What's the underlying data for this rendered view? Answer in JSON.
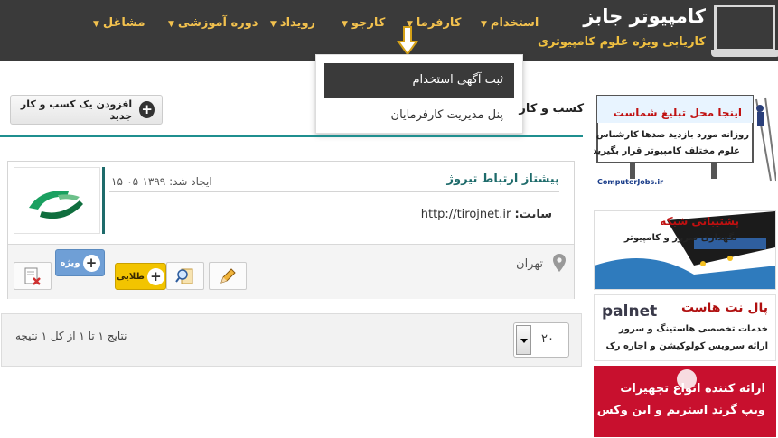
{
  "header": {
    "logo_title": "کامپیوتر جابز",
    "logo_subtitle": "کاریابی ویژه علوم کامپیوتری",
    "nav": [
      {
        "label": "استخدام"
      },
      {
        "label": "کارفرما"
      },
      {
        "label": "کارجو"
      },
      {
        "label": "رویداد"
      },
      {
        "label": "دوره آموزشی"
      },
      {
        "label": "مشاغل"
      }
    ]
  },
  "dropdown": {
    "items": [
      {
        "label": "ثبت آگهی استخدام"
      },
      {
        "label": "پنل مدیریت کارفرمایان"
      }
    ]
  },
  "section": {
    "title": "کسب و کار",
    "add_button": "افزودن یک کسب و کار جدید"
  },
  "listing": {
    "company": "پیشتاز ارتباط تیروژ",
    "created_label": "ایجاد شد: ۱۳۹۹-۰۵-۱۵",
    "site_label": "سایت:",
    "site_url": "http://tirojnet.ir",
    "city": "تهران",
    "logo_caption": "پیشتاز ارتباط تیروژ",
    "buttons": {
      "gold_label": "طلایی",
      "special_label": "ویژه"
    }
  },
  "pager": {
    "results": "نتایج ۱ تا ۱ از کل ۱ نتیجه",
    "page_size": "۲۰"
  },
  "ads": {
    "ad1_title": "اینجا محل تبلیغ شماست",
    "ad1_line1": "روزانه مورد بازدید صدها کارشناس و مدیر",
    "ad1_line2": "علوم مختلف کامپیوتر قرار بگیرید",
    "ad1_footer": "ComputerJobs.ir",
    "ad2_title": "پشتیبانی شبکه",
    "ad2_sub": "نگهداری سرور و کامپیوتر",
    "ad3_brand": "palnet",
    "ad3_title": "پال نت هاست",
    "ad3_line1": "خدمات تخصصی هاستینگ و سرور",
    "ad3_line2": "ارائه سرویس کولوکیشن و اجاره رک",
    "ad4_line1": "ارائه کننده انواع تجهیزات",
    "ad4_line2": "ویپ گرند استریم و این وکس"
  },
  "colors": {
    "header_bg": "#3a3a3a",
    "nav_text": "#f2c14e",
    "accent_teal": "#1e6b6b",
    "gold": "#f2c400",
    "special_blue": "#6f9fd6",
    "ad_red": "#c8102e"
  }
}
